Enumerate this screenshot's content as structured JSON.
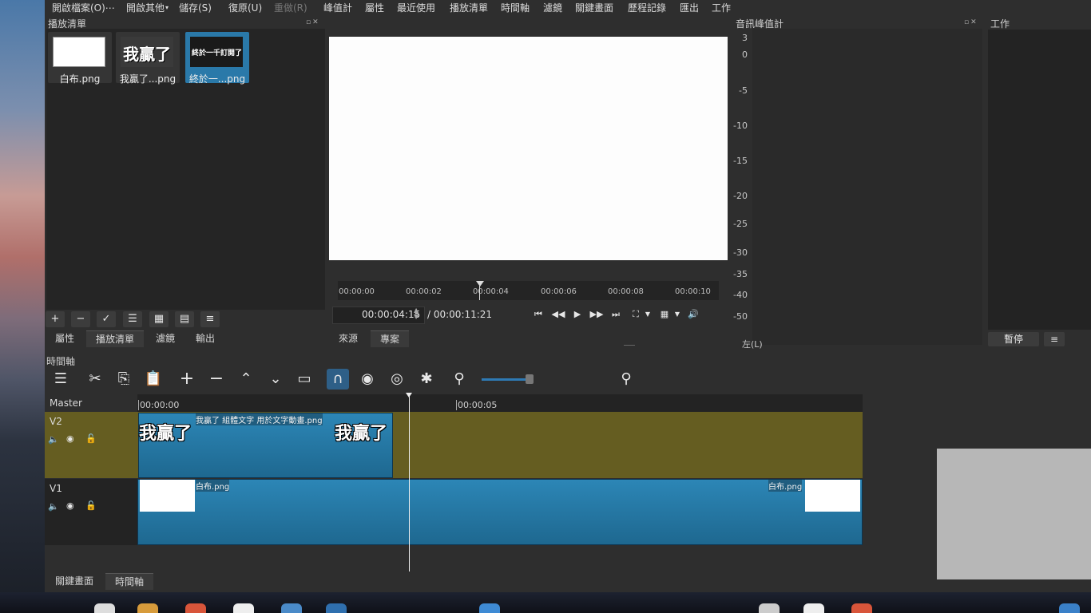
{
  "menubar": {
    "items": [
      "開啟檔案(O)⋯",
      "開啟其他",
      "儲存(S)",
      "復原(U)",
      "重做(R)",
      "峰值計",
      "屬性",
      "最近使用",
      "播放清單",
      "時間軸",
      "濾鏡",
      "關鍵畫面",
      "歷程記錄",
      "匯出",
      "工作"
    ]
  },
  "playlist": {
    "title": "播放清單",
    "items": [
      {
        "label": "白布.png",
        "image_text": ""
      },
      {
        "label": "我贏了...png",
        "image_text": "我贏了"
      },
      {
        "label": "終於一...png",
        "image_text": "終於一千訂閱了"
      }
    ],
    "buttons": [
      "+",
      "−",
      "✓",
      "☰",
      "▦",
      "▤",
      "≡"
    ]
  },
  "left_tabs": [
    "屬性",
    "播放清單",
    "濾鏡",
    "輸出"
  ],
  "player": {
    "ruler_ticks": [
      "00:00:00",
      "00:00:02",
      "00:00:04",
      "00:00:06",
      "00:00:08",
      "00:00:10"
    ],
    "current_time": "00:00:04:15",
    "total_time": "/ 00:00:11:21",
    "tabs": [
      "來源",
      "專案"
    ]
  },
  "meter": {
    "title": "音訊峰值計",
    "scale": [
      "3",
      "0",
      "-5",
      "-10",
      "-15",
      "-20",
      "-25",
      "-30",
      "-35",
      "-40",
      "-50"
    ],
    "channel_label": "左(L)"
  },
  "jobs": {
    "title": "工作",
    "pause_label": "暫停",
    "menu_label": "≡"
  },
  "timeline": {
    "title": "時間軸",
    "master_label": "Master",
    "ruler": [
      "00:00:00",
      "00:00:05"
    ],
    "tracks": [
      {
        "name": "V2",
        "clip_label": "我贏了 組體文字 用於文字動畫.png",
        "clip_text_start": "我贏了",
        "clip_text_end": "我贏了"
      },
      {
        "name": "V1",
        "clip_label_start": "白布.png",
        "clip_label_end": "白布.png"
      }
    ]
  },
  "bottom_tabs": [
    "關鍵畫面",
    "時間軸"
  ],
  "colors": {
    "accent": "#2a79a9",
    "v2_track": "#655d21",
    "clip_blue": "#1e6890"
  }
}
